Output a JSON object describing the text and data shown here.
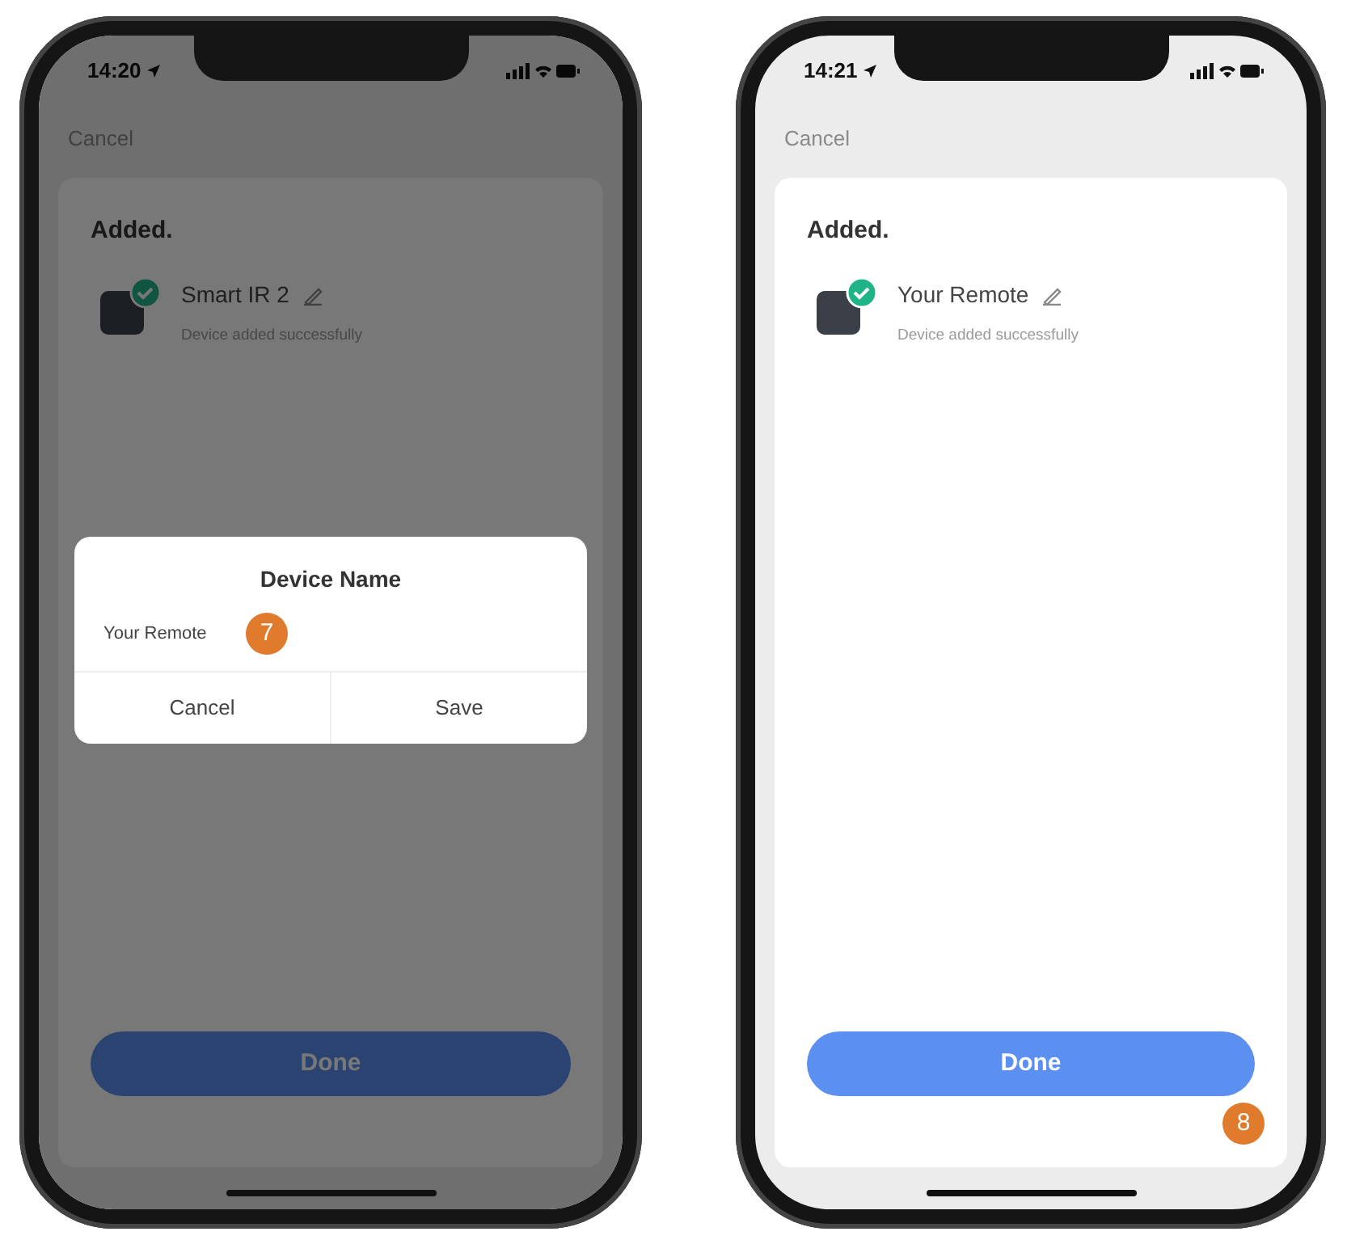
{
  "phones": [
    {
      "time": "14:20",
      "dimmed": true,
      "cancel_label": "Cancel",
      "card_title": "Added.",
      "device": {
        "name": "Smart IR 2",
        "status": "Device added successfully"
      },
      "done_label": "Done",
      "dialog": {
        "title": "Device Name",
        "value": "Your Remote",
        "step_badge": "7",
        "buttons": [
          "Cancel",
          "Save"
        ]
      }
    },
    {
      "time": "14:21",
      "dimmed": false,
      "cancel_label": "Cancel",
      "card_title": "Added.",
      "device": {
        "name": "Your Remote",
        "status": "Device added successfully"
      },
      "done_label": "Done",
      "step_badge": "8"
    }
  ]
}
